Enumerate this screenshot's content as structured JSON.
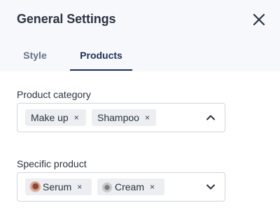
{
  "header": {
    "title": "General Settings",
    "tabs": [
      {
        "label": "Style",
        "active": false
      },
      {
        "label": "Products",
        "active": true
      }
    ]
  },
  "fields": {
    "product_category": {
      "label": "Product category",
      "chips": [
        {
          "label": "Make up",
          "remove": "×"
        },
        {
          "label": "Shampoo",
          "remove": "×"
        }
      ],
      "state": "expanded"
    },
    "specific_product": {
      "label": "Specific product",
      "chips": [
        {
          "label": "Serum",
          "remove": "×",
          "thumbnail": "serum-thumbnail"
        },
        {
          "label": "Cream",
          "remove": "×",
          "thumbnail": "cream-thumbnail"
        }
      ],
      "state": "collapsed"
    }
  },
  "icons": {
    "close": "close-icon",
    "chevron_up": "chevron-up-icon",
    "chevron_down": "chevron-down-icon"
  },
  "colors": {
    "header_background": "#f6f8fb",
    "active_tab": "#1e2f5c",
    "inactive_tab": "#647388",
    "chip_background": "#eceef1",
    "border": "#cfd5dd"
  }
}
